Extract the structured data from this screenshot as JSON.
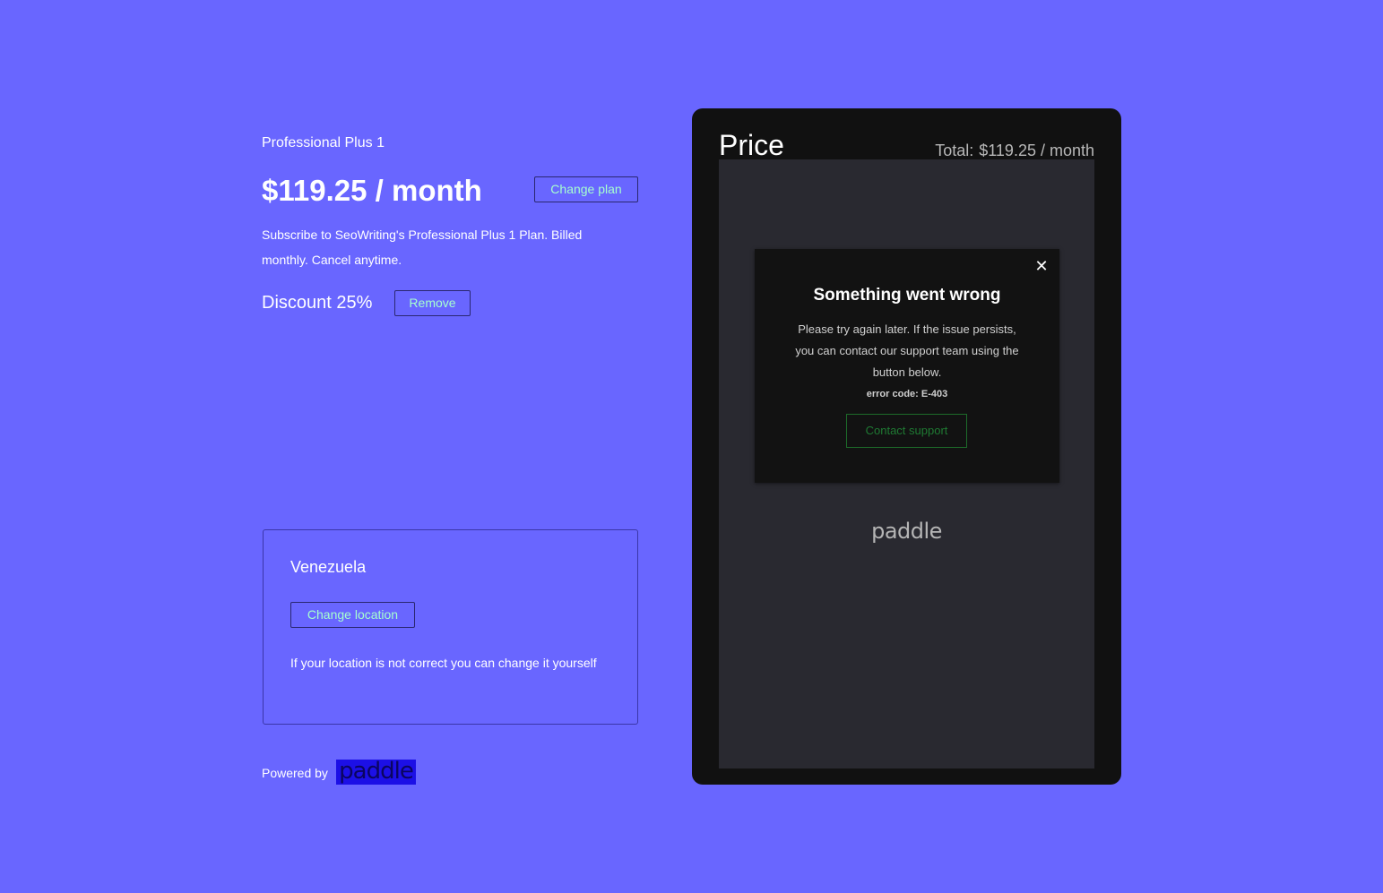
{
  "plan": {
    "name": "Professional Plus 1",
    "price": "$119.25 / month",
    "change_plan_label": "Change plan",
    "description": "Subscribe to SeoWriting's Professional Plus 1 Plan. Billed monthly. Cancel anytime.",
    "discount_label": "Discount 25%",
    "remove_label": "Remove"
  },
  "location": {
    "country": "Venezuela",
    "change_location_label": "Change location",
    "note": "If your location is not correct you can change it yourself"
  },
  "footer": {
    "powered_by": "Powered by",
    "brand": "paddle"
  },
  "checkout": {
    "title": "Price",
    "total_label": "Total:",
    "total_value": "$119.25 / month",
    "brand": "paddle",
    "error": {
      "close_symbol": "✕",
      "title": "Something went wrong",
      "message": "Please try again later. If the issue persists, you can contact our support team using the button below.",
      "code": "error code: E-403",
      "contact_label": "Contact support"
    }
  },
  "colors": {
    "background": "#6966ff",
    "button_text": "#a6ffcf",
    "panel": "#111111",
    "frame": "#292930",
    "contact_green": "#1f7a33"
  }
}
